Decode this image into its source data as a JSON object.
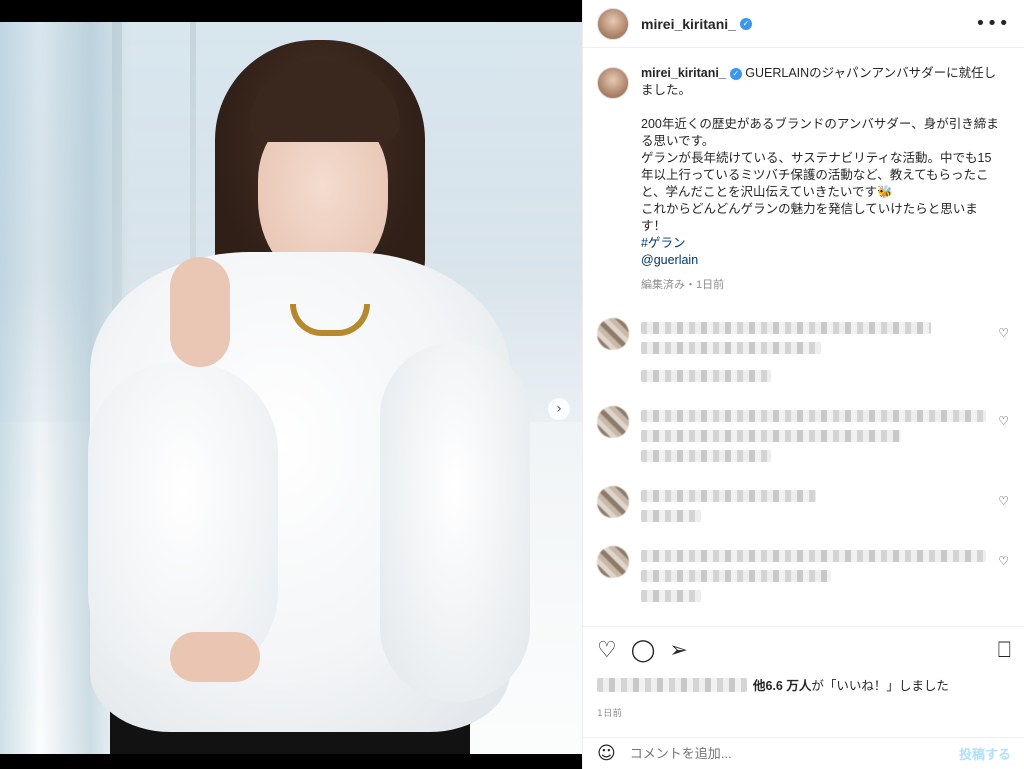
{
  "post": {
    "username": "mirei_kiritani_",
    "more_icon": "more-horizontal-icon",
    "verified_icon": "verified-badge-icon"
  },
  "caption": {
    "username": "mirei_kiritani_",
    "line1": "GUERLAINのジャパンアンバサダーに就任しました。",
    "para1": "200年近くの歴史があるブランドのアンバサダー、身が引き締まる思いです。",
    "para2": "ゲランが長年続けている、サステナビリティな活動。中でも15年以上行っているミツバチ保護の活動など、教えてもらったこと、学んだことを沢山伝えていきたいです🐝",
    "para3": "これからどんどんゲランの魅力を発信していけたらと思います！",
    "hashtag": "#ゲラン",
    "mention": "@guerlain",
    "edited": "編集済み・1日前"
  },
  "comments": [
    {
      "lines": [
        2,
        1
      ]
    },
    {
      "lines": [
        2,
        1
      ]
    },
    {
      "lines": [
        1,
        1
      ]
    },
    {
      "lines": [
        2,
        1
      ]
    }
  ],
  "likes": {
    "count_text": "他6.6 万人",
    "suffix_text": "が「いいね！」しました"
  },
  "timestamp": "1日前",
  "comment_input": {
    "placeholder": "コメントを追加...",
    "post_label": "投稿する"
  },
  "carousel": {
    "total": 2,
    "current": 1
  },
  "colors": {
    "accent": "#3897f0",
    "link": "#00376b",
    "muted": "#8e8e8e",
    "post_disabled": "#b2dffc"
  }
}
